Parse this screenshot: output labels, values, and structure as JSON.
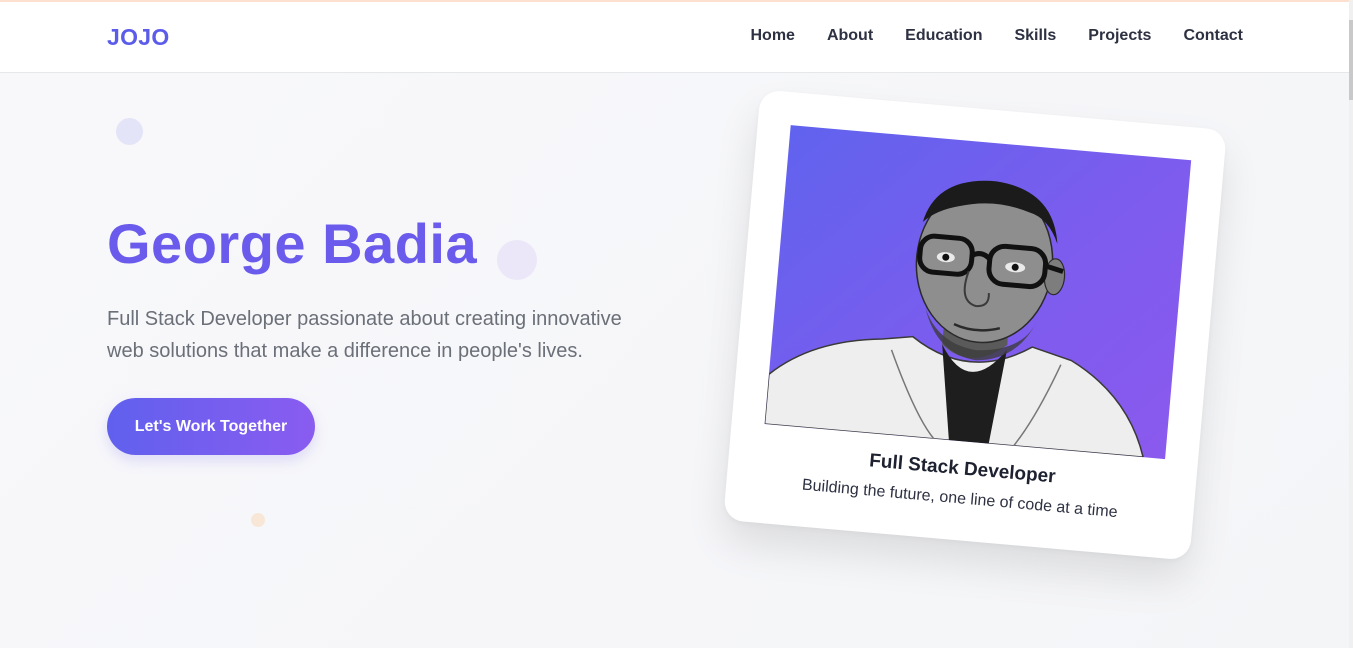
{
  "header": {
    "logo": "JOJO",
    "nav": [
      "Home",
      "About",
      "Education",
      "Skills",
      "Projects",
      "Contact"
    ]
  },
  "hero": {
    "name": "George Badia",
    "description": "Full Stack Developer passionate about creating innovative web solutions that make a difference in people's lives.",
    "cta_label": "Let's Work Together"
  },
  "card": {
    "title": "Full Stack Developer",
    "subtitle": "Building the future, one line of code at a time"
  },
  "colors": {
    "accent": "#6a5bec",
    "gradient_start": "#6060ee",
    "gradient_end": "#8a5cf0",
    "background": "#f6f7f9",
    "text_dark": "#2d3142",
    "text_muted": "#6b6f78"
  }
}
